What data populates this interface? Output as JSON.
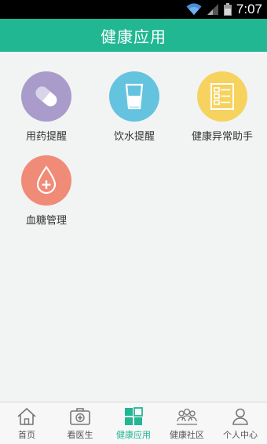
{
  "status_bar": {
    "time": "7:07",
    "icons": [
      "wifi-icon",
      "signal-icon",
      "battery-icon"
    ]
  },
  "header": {
    "title": "健康应用"
  },
  "apps": [
    {
      "label": "用药提醒",
      "icon": "pill-icon",
      "color": "#a99ccb"
    },
    {
      "label": "饮水提醒",
      "icon": "water-glass-icon",
      "color": "#64c3df"
    },
    {
      "label": "健康异常助手",
      "icon": "checklist-icon",
      "color": "#f6d25f"
    },
    {
      "label": "血糖管理",
      "icon": "blood-drop-icon",
      "color": "#f08b77"
    }
  ],
  "bottom_nav": {
    "active_color": "#21b793",
    "items": [
      {
        "label": "首页",
        "icon": "home-icon"
      },
      {
        "label": "看医生",
        "icon": "medical-kit-icon"
      },
      {
        "label": "健康应用",
        "icon": "apps-grid-icon",
        "active": true
      },
      {
        "label": "健康社区",
        "icon": "community-icon"
      },
      {
        "label": "个人中心",
        "icon": "person-icon"
      }
    ]
  }
}
